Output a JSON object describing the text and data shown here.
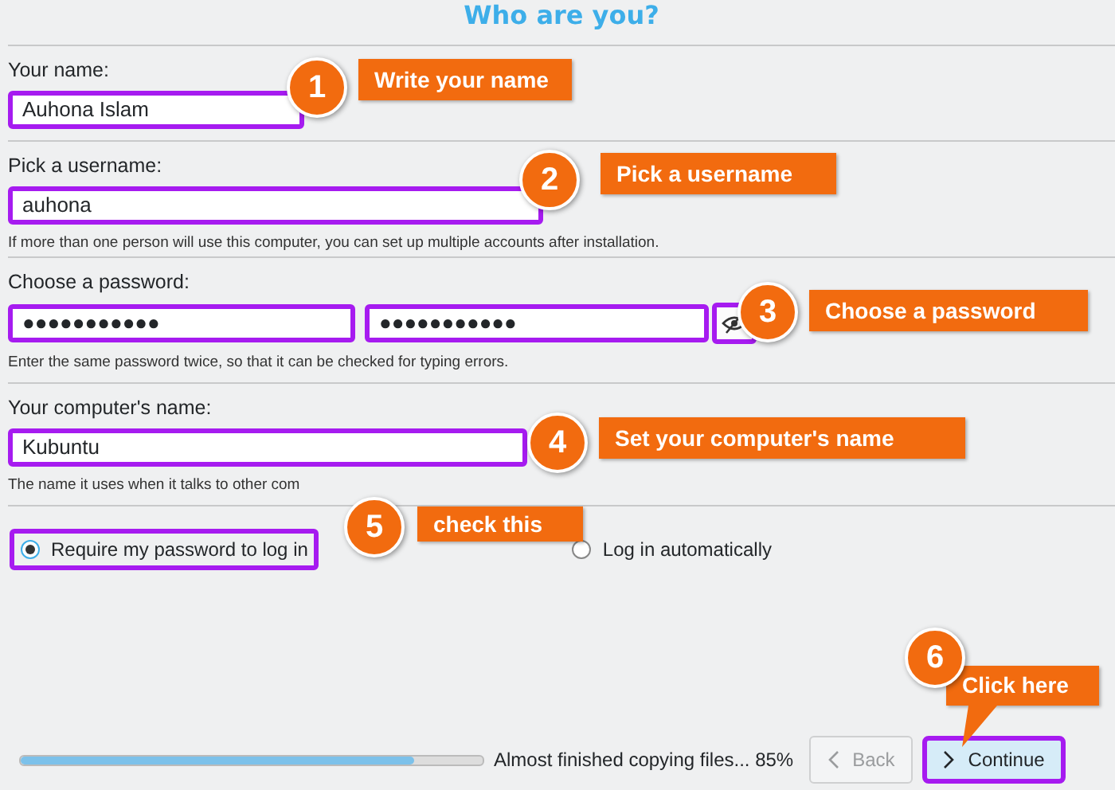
{
  "title": "Who are you?",
  "sections": [
    {
      "label": "Your name:",
      "fields": [
        {
          "value": "Auhona Islam",
          "highlighted": true
        }
      ]
    },
    {
      "label": "Pick a username:",
      "fields": [
        {
          "value": "auhona",
          "highlighted": true
        }
      ],
      "hint": "If more than one person will use this computer, you can set up multiple accounts after installation."
    },
    {
      "label": "Choose a password:",
      "fields": [
        {
          "value": "●●●●●●●●●●●",
          "highlighted": true
        },
        {
          "value": "●●●●●●●●●●●",
          "highlighted": true
        }
      ],
      "reveal_button": true,
      "hint": "Enter the same password twice, so that it can be checked for typing errors."
    },
    {
      "label": "Your computer's name:",
      "fields": [
        {
          "value": "Kubuntu",
          "highlighted": true
        }
      ],
      "hint": "The name it uses when it talks to other com"
    }
  ],
  "login_options": [
    {
      "label": "Require my password to log in",
      "selected": true,
      "highlighted": true
    },
    {
      "label": "Log in automatically",
      "selected": false,
      "highlighted": false
    }
  ],
  "progress": {
    "level": 0.85,
    "text": "Almost finished copying files... 85%"
  },
  "buttons": [
    {
      "label": "Back",
      "kind": "back",
      "disabled": true,
      "highlighted": false
    },
    {
      "label": "Continue",
      "kind": "next",
      "disabled": false,
      "highlighted": true
    }
  ],
  "annotations": [
    {
      "number": "1",
      "label": "Write your name"
    },
    {
      "number": "2",
      "label": "Pick a username"
    },
    {
      "number": "3",
      "label": "Choose a password"
    },
    {
      "number": "4",
      "label": "Set your computer's name"
    },
    {
      "number": "5",
      "label": "check this"
    },
    {
      "number": "6",
      "label": "Click here"
    }
  ]
}
